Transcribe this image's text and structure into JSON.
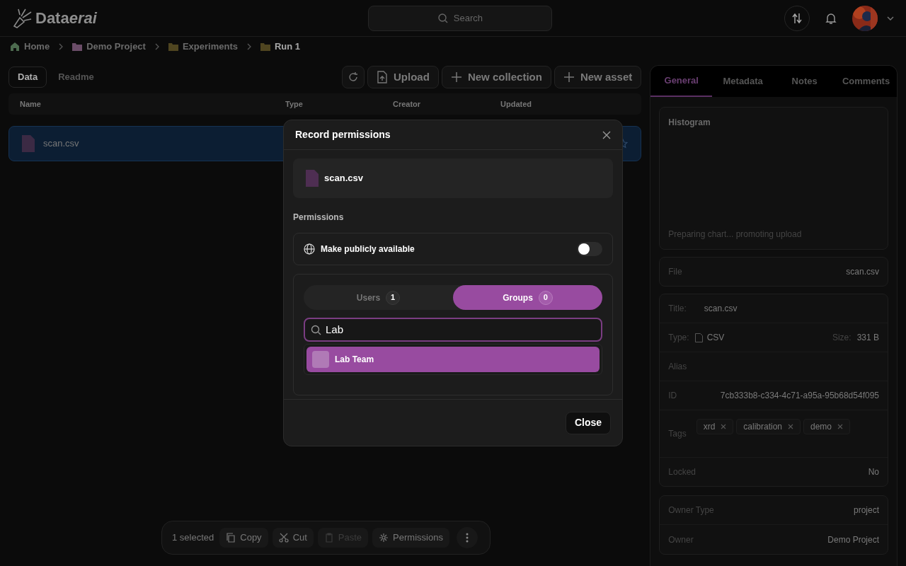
{
  "header": {
    "logo_main": "Data",
    "logo_accent": "erai",
    "search_placeholder": "Search"
  },
  "breadcrumbs": [
    {
      "label": "Home",
      "kind": "home",
      "current": false
    },
    {
      "label": "Demo Project",
      "kind": "project",
      "current": false
    },
    {
      "label": "Experiments",
      "kind": "folder",
      "current": false
    },
    {
      "label": "Run 1",
      "kind": "folder",
      "current": true
    }
  ],
  "view_tabs": [
    {
      "label": "Data",
      "selected": true
    },
    {
      "label": "Readme",
      "selected": false
    }
  ],
  "actions": [
    {
      "label": "Upload",
      "kind": "upload"
    },
    {
      "label": "New collection",
      "kind": "add"
    },
    {
      "label": "New asset",
      "kind": "add"
    }
  ],
  "table": {
    "columns": [
      "Name",
      "Type",
      "Creator",
      "Updated"
    ],
    "rows": [
      {
        "name": "scan.csv",
        "selected": true
      }
    ]
  },
  "modal": {
    "title": "Record permissions",
    "file": "scan.csv",
    "section": "Permissions",
    "public": {
      "label": "Make publicly available",
      "on": false
    },
    "tabs": [
      {
        "label": "Users",
        "count": "1",
        "selected": false
      },
      {
        "label": "Groups",
        "count": "0",
        "selected": true
      }
    ],
    "search_value": "Lab",
    "results": [
      {
        "label": "Lab Team",
        "selected": true
      }
    ],
    "close_button": "Close"
  },
  "side_tabs": [
    {
      "label": "General",
      "selected": true
    },
    {
      "label": "Metadata",
      "selected": false
    },
    {
      "label": "Notes",
      "selected": false
    },
    {
      "label": "Comments",
      "selected": false
    }
  ],
  "histogram": {
    "title": "Histogram",
    "status": "Preparing chart... promoting upload"
  },
  "file": {
    "label": "File",
    "value": "scan.csv"
  },
  "details": {
    "title_label": "Title:",
    "title": "scan.csv",
    "type_label": "Type:",
    "type": "CSV",
    "size_label": "Size:",
    "size": "331 B",
    "alias_label": "Alias",
    "id_label": "ID",
    "id": "7cb333b8-c334-4c71-a95a-95b68d54f095",
    "tags_label": "Tags",
    "tags": [
      "xrd",
      "calibration",
      "demo"
    ],
    "locked_label": "Locked",
    "locked": "No"
  },
  "owner": [
    {
      "label": "Owner Type",
      "value": "project"
    },
    {
      "label": "Owner",
      "value": "Demo Project"
    }
  ],
  "selection_bar": {
    "count": "1 selected",
    "actions": [
      {
        "label": "Copy",
        "kind": "copy",
        "disabled": false
      },
      {
        "label": "Cut",
        "kind": "cut",
        "disabled": false
      },
      {
        "label": "Paste",
        "kind": "paste",
        "disabled": true
      },
      {
        "label": "Permissions",
        "kind": "permissions",
        "disabled": false
      }
    ]
  }
}
